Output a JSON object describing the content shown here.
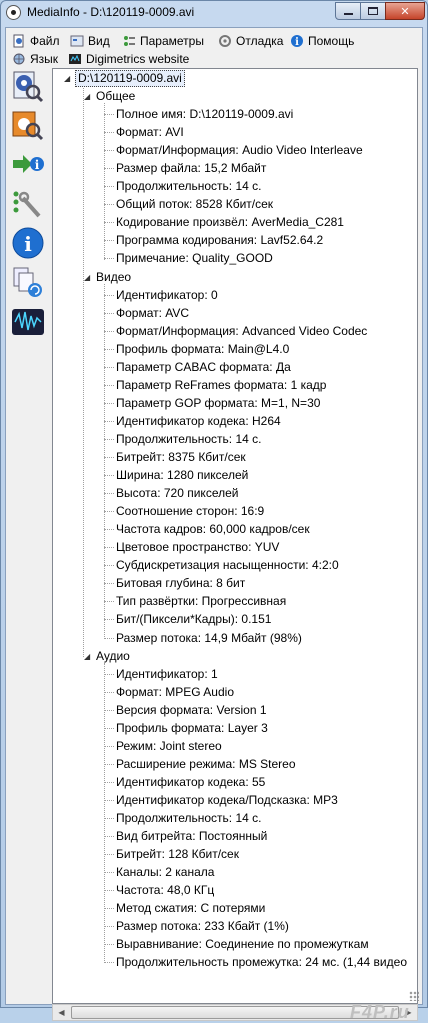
{
  "window": {
    "title": "MediaInfo - D:\\120119-0009.avi"
  },
  "menu": {
    "file": "Файл",
    "view": "Вид",
    "options": "Параметры",
    "debug": "Отладка",
    "help": "Помощь",
    "language": "Язык",
    "website": "Digimetrics website"
  },
  "sidebar": {
    "icons": [
      "basic-view-icon",
      "sheet-view-icon",
      "text-export-icon",
      "options-tools-icon",
      "info-icon",
      "compare-files-icon",
      "waveform-icon"
    ]
  },
  "tree": {
    "root": "D:\\120119-0009.avi",
    "sections": [
      {
        "title": "Общее",
        "items": [
          "Полное имя: D:\\120119-0009.avi",
          "Формат: AVI",
          "Формат/Информация: Audio Video Interleave",
          "Размер файла: 15,2 Мбайт",
          "Продолжительность: 14 с.",
          "Общий поток: 8528 Кбит/сек",
          "Кодирование произвёл: AverMedia_C281",
          "Программа кодирования: Lavf52.64.2",
          "Примечание: Quality_GOOD"
        ]
      },
      {
        "title": "Видео",
        "items": [
          "Идентификатор: 0",
          "Формат: AVC",
          "Формат/Информация: Advanced Video Codec",
          "Профиль формата: Main@L4.0",
          "Параметр CABAC формата: Да",
          "Параметр ReFrames формата: 1 кадр",
          "Параметр GOP формата: M=1, N=30",
          "Идентификатор кодека: H264",
          "Продолжительность: 14 с.",
          "Битрейт: 8375 Кбит/сек",
          "Ширина: 1280 пикселей",
          "Высота: 720 пикселей",
          "Соотношение сторон: 16:9",
          "Частота кадров: 60,000 кадров/сек",
          "Цветовое пространство: YUV",
          "Субдискретизация насыщенности: 4:2:0",
          "Битовая глубина: 8 бит",
          "Тип развёртки: Прогрессивная",
          "Бит/(Пиксели*Кадры): 0.151",
          "Размер потока: 14,9 Мбайт (98%)"
        ]
      },
      {
        "title": "Аудио",
        "items": [
          "Идентификатор: 1",
          "Формат: MPEG Audio",
          "Версия формата: Version 1",
          "Профиль формата: Layer 3",
          "Режим: Joint stereo",
          "Расширение режима: MS Stereo",
          "Идентификатор кодека: 55",
          "Идентификатор кодека/Подсказка: MP3",
          "Продолжительность: 14 с.",
          "Вид битрейта: Постоянный",
          "Битрейт: 128 Кбит/сек",
          "Каналы: 2 канала",
          "Частота: 48,0 КГц",
          "Метод сжатия: С потерями",
          "Размер потока: 233 Кбайт (1%)",
          "Выравнивание: Соединение по промежуткам",
          "Продолжительность промежутка: 24  мс. (1,44 видео"
        ]
      }
    ]
  },
  "watermark": "F4P.ru"
}
